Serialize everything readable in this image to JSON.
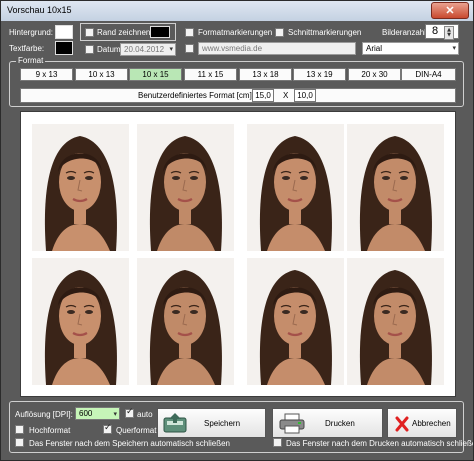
{
  "window": {
    "title": "Vorschau 10x15",
    "close_label": "✕"
  },
  "top": {
    "hintergrund_label": "Hintergrund:",
    "textfarbe_label": "Textfarbe:",
    "hintergrund_color": "#ffffff",
    "textfarbe_color": "#000000",
    "rand_label": "Rand zeichnen",
    "rand_color": "#000000",
    "rand_checked": false,
    "datum_label": "Datum",
    "datum_checked": false,
    "datum_value": "20.04.2012",
    "formatmark_label": "Formatmarkierungen",
    "formatmark_checked": false,
    "schnittmark_label": "Schnittmarkierungen",
    "schnittmark_checked": false,
    "url_checked": false,
    "url_value": "www.vsmedia.de",
    "bilderanzahl_label": "Bilderanzahl:",
    "bilderanzahl_value": "8",
    "font_value": "Arial"
  },
  "format": {
    "legend": "Format",
    "buttons": [
      {
        "label": "9 x 13",
        "selected": false
      },
      {
        "label": "10 x 13",
        "selected": false
      },
      {
        "label": "10 x 15",
        "selected": true
      },
      {
        "label": "11 x 15",
        "selected": false
      },
      {
        "label": "13 x 18",
        "selected": false
      },
      {
        "label": "13 x 19",
        "selected": false
      },
      {
        "label": "20 x 30",
        "selected": false
      },
      {
        "label": "DIN-A4",
        "selected": false
      }
    ],
    "custom_label": "Benutzerdefiniertes Format [cm]:",
    "custom_w": "15,0",
    "custom_x": "X",
    "custom_h": "10,0"
  },
  "preview": {
    "photo_count": 8
  },
  "bottom": {
    "dpi_label": "Auflösung [DPI]:",
    "dpi_value": "600",
    "dpi_color": "#c6f5b8",
    "auto_label": "auto",
    "auto_checked": true,
    "hochformat_label": "Hochformat",
    "hochformat_checked": false,
    "querformat_label": "Querformat",
    "querformat_checked": true,
    "close_after_save_label": "Das Fenster nach dem Speichern automatisch schließen",
    "close_after_save_checked": false,
    "close_after_print_label": "Das Fenster nach dem Drucken automatisch schließen",
    "close_after_print_checked": false,
    "save_label": "Speichern",
    "print_label": "Drucken",
    "cancel_label": "Abbrechen",
    "cancel_icon_color": "#e02020"
  }
}
